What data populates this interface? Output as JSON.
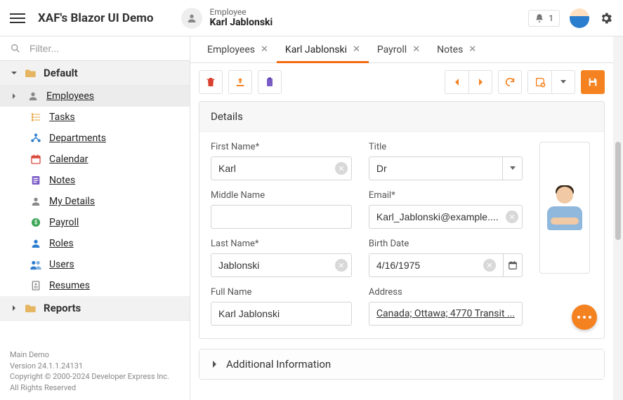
{
  "header": {
    "app_title": "XAF's Blazor UI Demo",
    "context_label": "Employee",
    "context_name": "Karl Jablonski",
    "notif_count": "1"
  },
  "filter": {
    "placeholder": "Filter..."
  },
  "sidebar": {
    "group1": "Default",
    "items": {
      "employees": "Employees",
      "tasks": "Tasks",
      "departments": "Departments",
      "calendar": "Calendar",
      "notes": "Notes",
      "mydetails": "My Details",
      "payroll": "Payroll",
      "roles": "Roles",
      "users": "Users",
      "resumes": "Resumes"
    },
    "group2": "Reports"
  },
  "footer": {
    "l1": "Main Demo",
    "l2": "Version 24.1.1.24131",
    "l3": "Copyright © 2000-2024 Developer Express Inc.",
    "l4": "All Rights Reserved"
  },
  "tabs": {
    "t1": "Employees",
    "t2": "Karl Jablonski",
    "t3": "Payroll",
    "t4": "Notes"
  },
  "details": {
    "panel_title": "Details",
    "first_name_label": "First Name*",
    "first_name": "Karl",
    "middle_name_label": "Middle Name",
    "middle_name": "",
    "last_name_label": "Last Name*",
    "last_name": "Jablonski",
    "full_name_label": "Full Name",
    "full_name": "Karl Jablonski",
    "title_label": "Title",
    "title": "Dr",
    "email_label": "Email*",
    "email": "Karl_Jablonski@example....",
    "birth_label": "Birth Date",
    "birth": "4/16/1975",
    "address_label": "Address",
    "address": "Canada; Ottawa; 4770 Transit ..."
  },
  "additional": {
    "title": "Additional Information"
  }
}
